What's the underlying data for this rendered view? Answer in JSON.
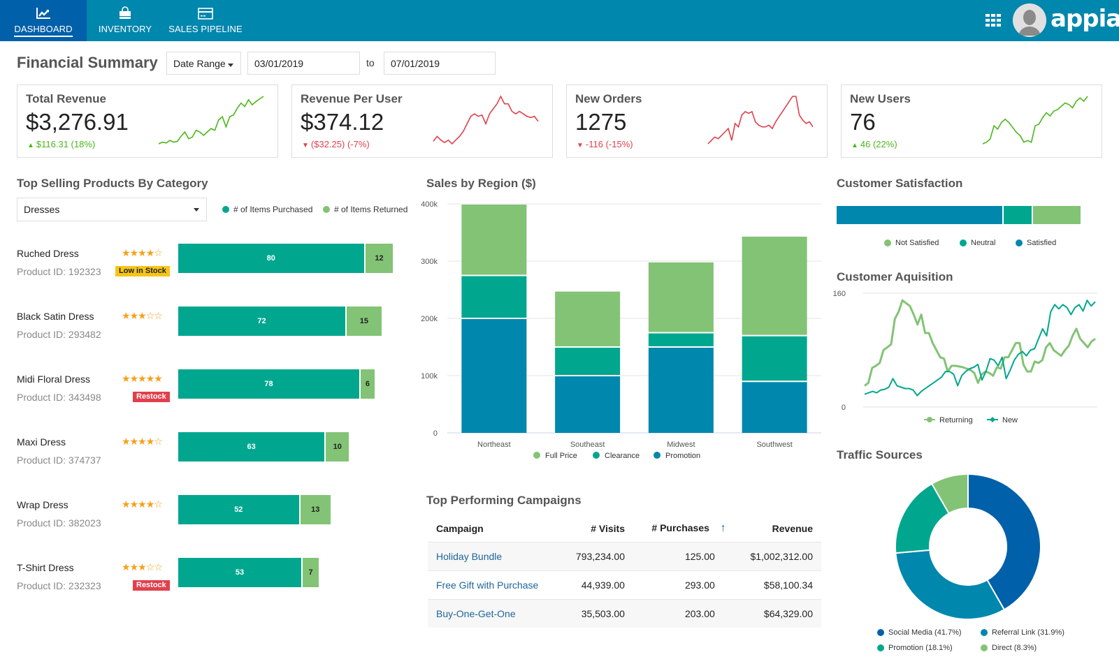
{
  "nav": {
    "tabs": [
      {
        "label": "DASHBOARD",
        "icon": "line-chart-icon",
        "active": true
      },
      {
        "label": "INVENTORY",
        "icon": "shopping-bag-icon",
        "active": false
      },
      {
        "label": "SALES PIPELINE",
        "icon": "credit-card-icon",
        "active": false
      }
    ],
    "apps_icon": "grid-icon",
    "avatar_icon": "user-avatar-icon",
    "logo": "appian"
  },
  "header": {
    "title": "Financial Summary",
    "date_range_select": "Date Range",
    "start_date": "03/01/2019",
    "to_label": "to",
    "end_date": "07/01/2019"
  },
  "kpis": [
    {
      "title": "Total Revenue",
      "value": "$3,276.91",
      "delta": "$116.31 (18%)",
      "direction": "up",
      "color": "#4cb71a",
      "spark": [
        4,
        6,
        5,
        8,
        6,
        7,
        13,
        18,
        10,
        12,
        20,
        18,
        14,
        18,
        22,
        20,
        32,
        36,
        24,
        36,
        38,
        46,
        52,
        48,
        56,
        50,
        54,
        57,
        60
      ]
    },
    {
      "title": "Revenue Per User",
      "value": "$374.12",
      "delta": "($32.25) (-7%)",
      "direction": "down",
      "color": "#e1404b",
      "spark": [
        14,
        18,
        15,
        13,
        15,
        12,
        15,
        18,
        22,
        28,
        34,
        36,
        34,
        35,
        28,
        36,
        40,
        44,
        50,
        44,
        44,
        38,
        36,
        38,
        36,
        34,
        33,
        34,
        30
      ]
    },
    {
      "title": "New Orders",
      "value": "1275",
      "delta": "-116 (-15%)",
      "direction": "down",
      "color": "#e1404b",
      "spark": [
        10,
        14,
        18,
        16,
        20,
        24,
        28,
        14,
        34,
        30,
        44,
        48,
        46,
        48,
        36,
        32,
        30,
        30,
        32,
        28,
        36,
        42,
        48,
        54,
        60,
        66,
        66,
        44,
        38,
        34,
        36,
        30
      ]
    },
    {
      "title": "New Users",
      "value": "76",
      "delta": "46 (22%)",
      "direction": "up",
      "color": "#4cb71a",
      "spark": [
        8,
        10,
        14,
        30,
        26,
        34,
        38,
        34,
        28,
        22,
        18,
        10,
        12,
        10,
        30,
        32,
        40,
        46,
        42,
        48,
        50,
        54,
        58,
        56,
        52,
        60,
        64,
        60,
        66
      ]
    }
  ],
  "top_selling": {
    "title": "Top Selling Products By Category",
    "category": "Dresses",
    "legend": [
      {
        "label": "# of Items Purchased",
        "color": "#00a78e"
      },
      {
        "label": "# of Items Returned",
        "color": "#83c375"
      }
    ],
    "products": [
      {
        "name": "Ruched Dress",
        "id": "Product ID: 192323",
        "rating": 4,
        "badge": "Low in Stock",
        "badge_type": "warning",
        "purchased": 80,
        "returned": 12
      },
      {
        "name": "Black Satin Dress",
        "id": "Product ID: 293482",
        "rating": 3,
        "badge": "",
        "badge_type": "",
        "purchased": 72,
        "returned": 15
      },
      {
        "name": "Midi Floral Dress",
        "id": "Product ID: 343498",
        "rating": 5,
        "badge": "Restock",
        "badge_type": "danger",
        "purchased": 78,
        "returned": 6
      },
      {
        "name": "Maxi Dress",
        "id": "Product ID: 374737",
        "rating": 4,
        "badge": "",
        "badge_type": "",
        "purchased": 63,
        "returned": 10
      },
      {
        "name": "Wrap Dress",
        "id": "Product ID: 382023",
        "rating": 4,
        "badge": "",
        "badge_type": "",
        "purchased": 52,
        "returned": 13
      },
      {
        "name": "T-Shirt Dress",
        "id": "Product ID: 232323",
        "rating": 3,
        "badge": "Restock",
        "badge_type": "danger",
        "purchased": 53,
        "returned": 7
      }
    ]
  },
  "chart_data": [
    {
      "type": "bar",
      "stacked": true,
      "title": "Sales by Region ($)",
      "categories": [
        "Northeast",
        "Southeast",
        "Midwest",
        "Southwest"
      ],
      "series": [
        {
          "name": "Promotion",
          "color": "#0087ad",
          "values": [
            200000,
            100000,
            150000,
            90000
          ]
        },
        {
          "name": "Clearance",
          "color": "#00a78e",
          "values": [
            75000,
            50000,
            25000,
            80000
          ]
        },
        {
          "name": "Full Price",
          "color": "#83c375",
          "values": [
            125000,
            98000,
            124000,
            174000
          ]
        }
      ],
      "legend": [
        "Full Price",
        "Clearance",
        "Promotion"
      ],
      "ylim": [
        0,
        400000
      ],
      "yticks": [
        "0",
        "100k",
        "200k",
        "300k",
        "400k"
      ],
      "grid": true,
      "legend_position": "bottom"
    },
    {
      "type": "bar",
      "stacked": true,
      "orientation": "horizontal",
      "title": "Customer Satisfaction",
      "series": [
        {
          "name": "Satisfied",
          "color": "#0087ad",
          "value": 68
        },
        {
          "name": "Neutral",
          "color": "#00a78e",
          "value": 12
        },
        {
          "name": "Not Satisfied",
          "color": "#83c375",
          "value": 20
        }
      ],
      "legend": [
        "Not Satisfied",
        "Neutral",
        "Satisfied"
      ],
      "legend_position": "bottom"
    },
    {
      "type": "line",
      "title": "Customer Aquisition",
      "ylim": [
        0,
        160
      ],
      "yticks": [
        "0",
        "160"
      ],
      "series": [
        {
          "name": "Returning",
          "color": "#83c375",
          "values": [
            30,
            34,
            55,
            58,
            62,
            80,
            84,
            88,
            124,
            134,
            150,
            146,
            142,
            130,
            116,
            130,
            104,
            104,
            90,
            80,
            70,
            68,
            50,
            58,
            58,
            57,
            56,
            54,
            52,
            48,
            34,
            46,
            50,
            48,
            44,
            56,
            54,
            70,
            70,
            80,
            90,
            90,
            60,
            50,
            50,
            64,
            62,
            66,
            84,
            90,
            80,
            76,
            72,
            80,
            86,
            100,
            110,
            96,
            90,
            84,
            92,
            96
          ]
        },
        {
          "name": "New",
          "color": "#00a78e",
          "values": [
            18,
            20,
            22,
            20,
            24,
            25,
            28,
            40,
            30,
            28,
            26,
            26,
            24,
            16,
            22,
            26,
            30,
            34,
            38,
            42,
            50,
            50,
            46,
            30,
            44,
            50,
            54,
            56,
            60,
            38,
            50,
            68,
            66,
            58,
            70,
            40,
            52,
            66,
            74,
            78,
            72,
            80,
            82,
            96,
            110,
            100,
            134,
            144,
            138,
            144,
            140,
            130,
            140,
            144,
            135,
            150,
            142,
            148
          ]
        }
      ],
      "legend_position": "bottom"
    },
    {
      "type": "pie",
      "donut": true,
      "title": "Traffic Sources",
      "slices": [
        {
          "label": "Social Media (41.7%)",
          "value": 41.7,
          "color": "#0060a9"
        },
        {
          "label": "Referral Link (31.9%)",
          "value": 31.9,
          "color": "#0087ad"
        },
        {
          "label": "Promotion (18.1%)",
          "value": 18.1,
          "color": "#00a78e"
        },
        {
          "label": "Direct (8.3%)",
          "value": 8.3,
          "color": "#83c375"
        }
      ],
      "legend_position": "bottom"
    }
  ],
  "campaigns": {
    "title": "Top Performing Campaigns",
    "columns": [
      "Campaign",
      "# Visits",
      "# Purchases",
      "Revenue"
    ],
    "sort_icon": "sort-ascending-icon",
    "rows": [
      {
        "campaign": "Holiday Bundle",
        "visits": "793,234.00",
        "purchases": "125.00",
        "revenue": "$1,002,312.00"
      },
      {
        "campaign": "Free Gift with Purchase",
        "visits": "44,939.00",
        "purchases": "293.00",
        "revenue": "$58,100.34"
      },
      {
        "campaign": "Buy-One-Get-One",
        "visits": "35,503.00",
        "purchases": "203.00",
        "revenue": "$64,329.00"
      }
    ]
  }
}
